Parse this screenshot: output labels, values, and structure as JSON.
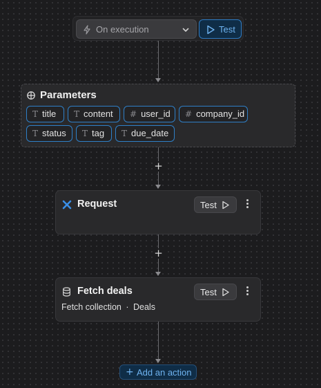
{
  "trigger": {
    "select_value": "On execution",
    "test_label": "Test"
  },
  "parameters": {
    "title": "Parameters",
    "chips": [
      {
        "type": "T",
        "label": "title"
      },
      {
        "type": "T",
        "label": "content"
      },
      {
        "type": "#",
        "label": "user_id"
      },
      {
        "type": "#",
        "label": "company_id"
      },
      {
        "type": "T",
        "label": "status"
      },
      {
        "type": "T",
        "label": "tag"
      },
      {
        "type": "T",
        "label": "due_date"
      }
    ]
  },
  "request_card": {
    "title": "Request",
    "test_label": "Test"
  },
  "fetch_card": {
    "title": "Fetch deals",
    "test_label": "Test",
    "subtitle_part1": "Fetch collection",
    "subtitle_sep": "·",
    "subtitle_part2": "Deals"
  },
  "add_action": {
    "plus": "+",
    "label": "Add an action"
  },
  "connectors": {
    "plus_1": "+",
    "plus_2": "+"
  },
  "colors": {
    "accent": "#2f7cc4",
    "accent_text": "#6fb3f0",
    "card_bg": "#29292b",
    "canvas_bg": "#1c1c1e"
  }
}
